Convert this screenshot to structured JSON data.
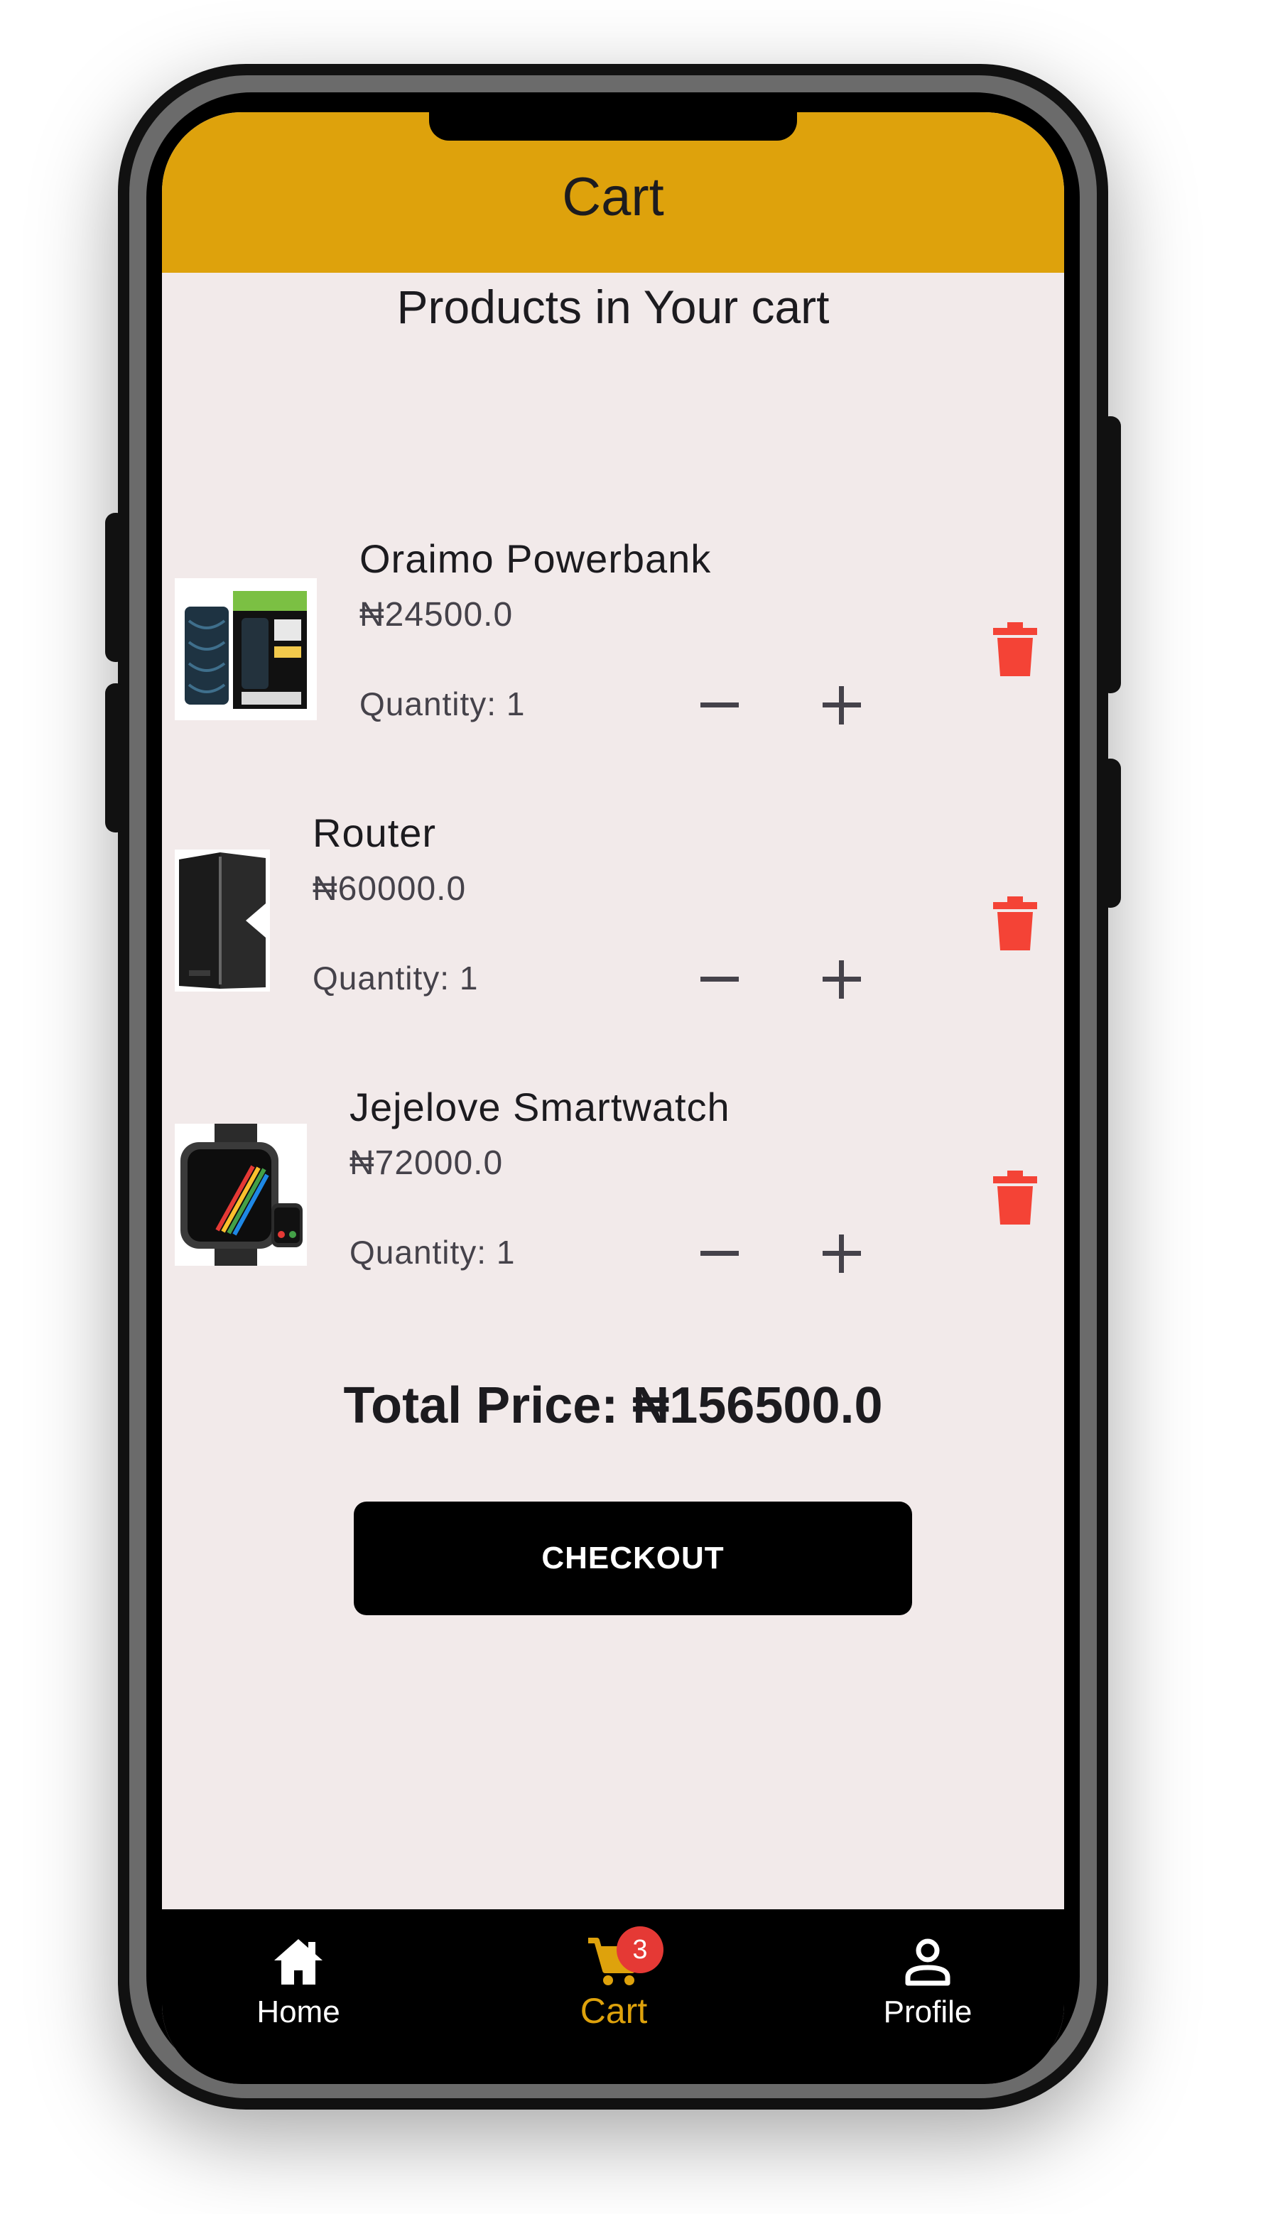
{
  "appbar": {
    "title": "Cart"
  },
  "section_title": "Products in Your cart",
  "cart_items": [
    {
      "name": "Oraimo Powerbank",
      "price": "₦24500.0",
      "quantity": "Quantity: 1"
    },
    {
      "name": "Router",
      "price": "₦60000.0",
      "quantity": "Quantity: 1"
    },
    {
      "name": "Jejelove Smartwatch",
      "price": "₦72000.0",
      "quantity": "Quantity: 1"
    }
  ],
  "total_price": "Total Price: ₦156500.0",
  "checkout_label": "CHECKOUT",
  "bottom_nav": {
    "items": [
      {
        "label": "Home",
        "icon": "home-icon"
      },
      {
        "label": "Cart",
        "icon": "cart-icon",
        "badge": "3",
        "active": true
      },
      {
        "label": "Profile",
        "icon": "profile-icon"
      }
    ]
  },
  "colors": {
    "appbar": "#dea20c",
    "background": "#f2eaea",
    "delete": "#f44336",
    "active_nav": "#dea20c",
    "badge": "#e53935"
  }
}
